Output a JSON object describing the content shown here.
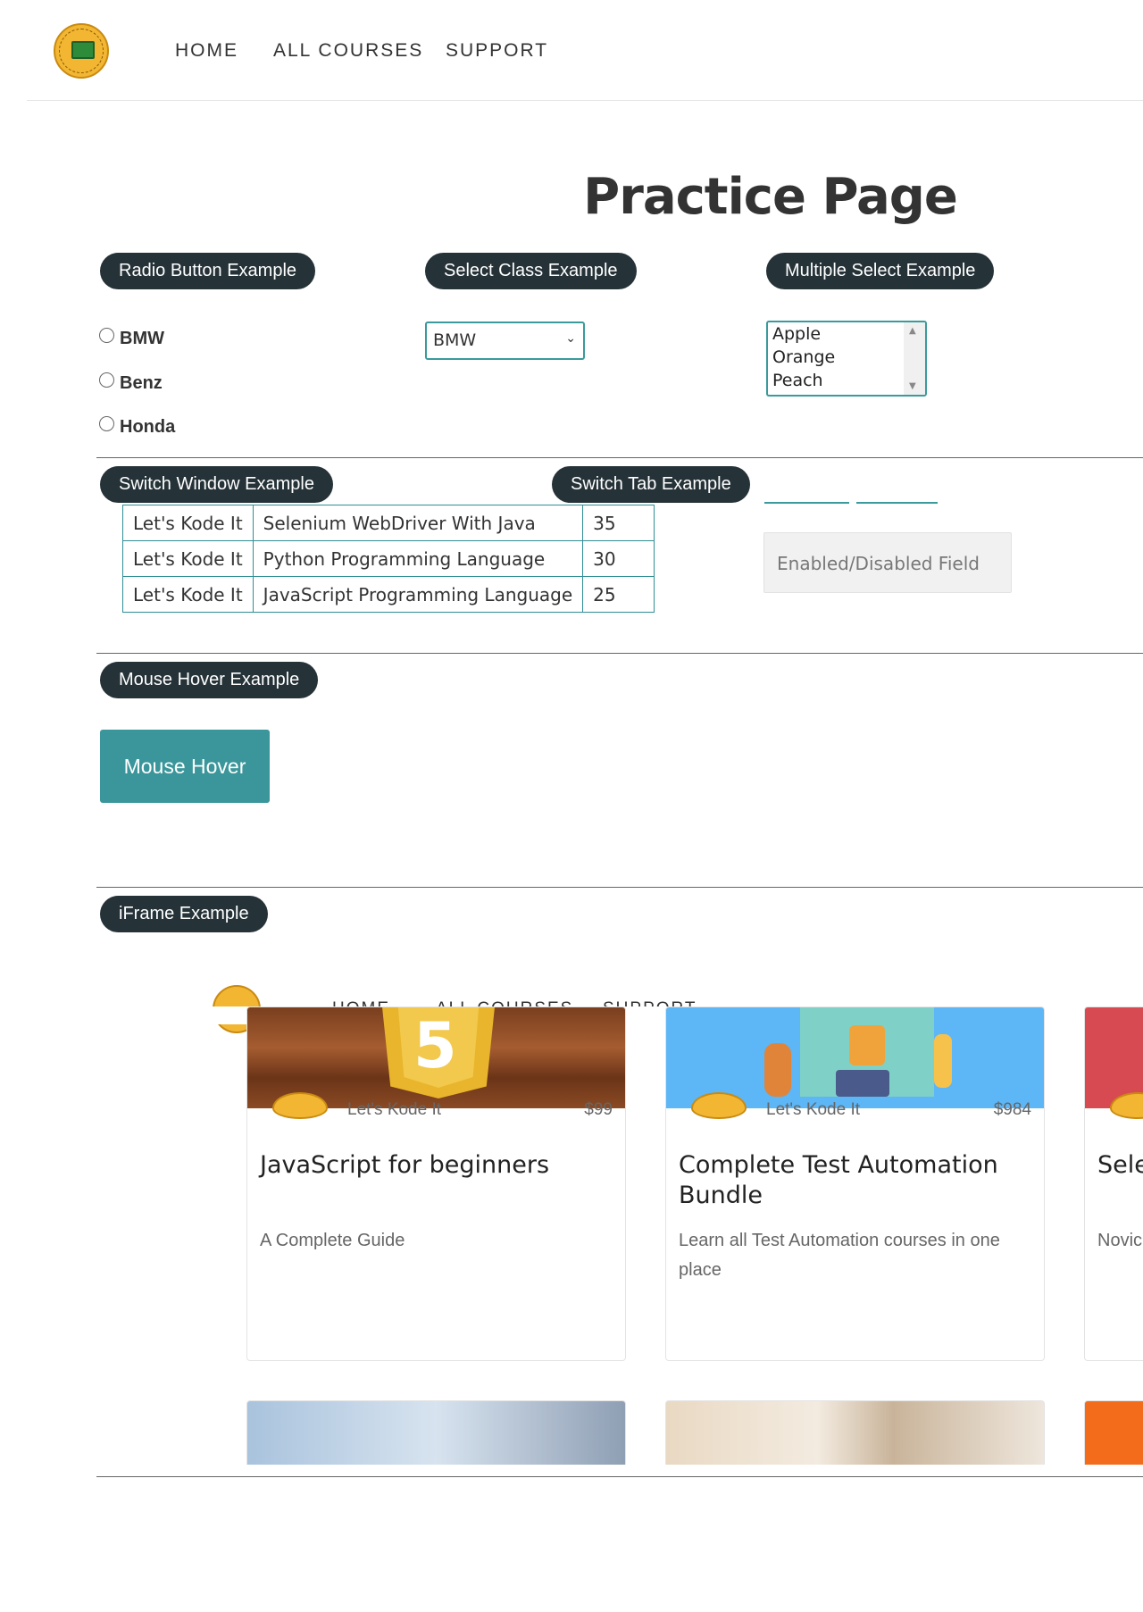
{
  "nav": {
    "home": "HOME",
    "courses": "ALL COURSES",
    "support": "SUPPORT"
  },
  "page_title": "Practice Page",
  "radio_section": {
    "label": "Radio Button Example",
    "options": [
      "BMW",
      "Benz",
      "Honda"
    ]
  },
  "select_section": {
    "label": "Select Class Example",
    "selected": "BMW"
  },
  "multi_select_section": {
    "label": "Multiple Select Example",
    "options": [
      "Apple",
      "Orange",
      "Peach"
    ]
  },
  "switch_window": {
    "label": "Switch Window Example"
  },
  "switch_tab": {
    "label": "Switch Tab Example"
  },
  "course_table": {
    "rows": [
      [
        "Let's Kode It",
        "Selenium WebDriver With Java",
        "35"
      ],
      [
        "Let's Kode It",
        "Python Programming Language",
        "30"
      ],
      [
        "Let's Kode It",
        "JavaScript Programming Language",
        "25"
      ]
    ]
  },
  "enabled_field": {
    "placeholder": "Enabled/Disabled Field"
  },
  "mouse_hover": {
    "label": "Mouse Hover Example",
    "button": "Mouse Hover"
  },
  "iframe": {
    "label": "iFrame Example",
    "cards": [
      {
        "author": "Let's Kode It",
        "price": "$99",
        "title": "JavaScript for beginners",
        "desc": "A Complete Guide"
      },
      {
        "author": "Let's Kode It",
        "price": "$984",
        "title": "Complete Test Automation Bundle",
        "desc": "Learn all Test Automation courses in one place"
      },
      {
        "title": "Sele Pytl",
        "desc": "Novic frame"
      }
    ]
  },
  "colors": {
    "pill_bg": "#253238",
    "accent": "#3a969a"
  }
}
